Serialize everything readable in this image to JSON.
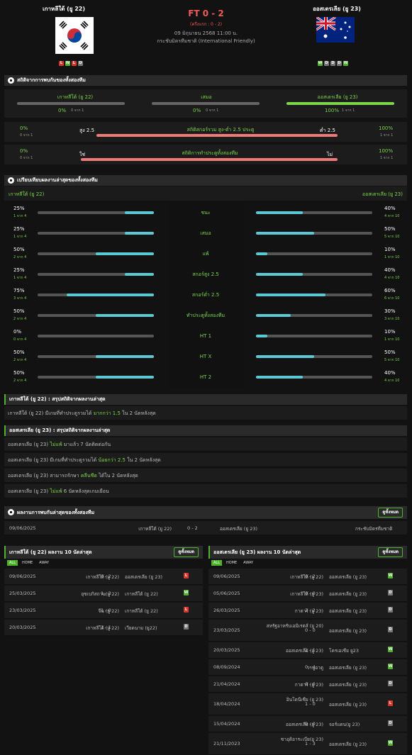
{
  "header": {
    "home_name": "เกาหลีใต้ (ยู 22)",
    "away_name": "ออสเตรเลีย (ยู 23)",
    "score": "FT 0 - 2",
    "halftime": "(ครึ่งแรก : 0 - 2)",
    "date": "09 มิถุนายน 2568 11:00 น.",
    "competition": "กระชับมิตรทีมชาติ (International Friendly)",
    "home_form": [
      "L",
      "W",
      "L",
      "D"
    ],
    "away_form": [
      "W",
      "D",
      "D",
      "D",
      "W"
    ]
  },
  "h2h_section": {
    "title": "สถิติจากการพบกันของทั้งสองทีม",
    "home_label": "เกาหลีใต้ (ยู 22)",
    "draw_label": "เสมอ",
    "away_label": "ออสเตรเลีย (ยู 23)",
    "home_pct": "0%",
    "home_count": "0 จาก 1",
    "draw_pct": "0%",
    "draw_count": "0 จาก 1",
    "away_pct": "100%",
    "away_count": "1 จาก 1",
    "ou_title": "สถิติสกอร์รวม สูง-ต่ำ 2.5 ประตู",
    "ou_left_pct": "0%",
    "ou_left_count": "0 จาก 1",
    "ou_over": "สูง 2.5",
    "ou_under": "ต่ำ 2.5",
    "ou_right_pct": "100%",
    "ou_right_count": "1 จาก 1",
    "btts_title": "สถิติการทำประตูทั้งสองทีม",
    "btts_left_pct": "0%",
    "btts_left_count": "0 จาก 1",
    "btts_yes": "ใช่",
    "btts_no": "ไม่",
    "btts_right_pct": "100%",
    "btts_right_count": "1 จาก 1"
  },
  "compare": {
    "title": "เปรียบเทียบผลงานล่าสุดของทั้งสองทีม",
    "home_label": "เกาหลีใต้ (ยู 22)",
    "away_label": "ออสเตรเลีย (ยู 23)",
    "rows": [
      {
        "label": "ชนะ",
        "home_pct": "25%",
        "home_count": "1 จาก 4",
        "home_val": 0.25,
        "away_pct": "40%",
        "away_count": "4 จาก 10",
        "away_val": 0.4
      },
      {
        "label": "เสมอ",
        "home_pct": "25%",
        "home_count": "1 จาก 4",
        "home_val": 0.25,
        "away_pct": "50%",
        "away_count": "5 จาก 10",
        "away_val": 0.5
      },
      {
        "label": "แพ้",
        "home_pct": "50%",
        "home_count": "2 จาก 4",
        "home_val": 0.5,
        "away_pct": "10%",
        "away_count": "1 จาก 10",
        "away_val": 0.1
      },
      {
        "label": "สกอร์สูง 2.5",
        "home_pct": "25%",
        "home_count": "1 จาก 4",
        "home_val": 0.25,
        "away_pct": "40%",
        "away_count": "4 จาก 10",
        "away_val": 0.4
      },
      {
        "label": "สกอร์ต่ำ 2.5",
        "home_pct": "75%",
        "home_count": "3 จาก 4",
        "home_val": 0.75,
        "away_pct": "60%",
        "away_count": "6 จาก 10",
        "away_val": 0.6
      },
      {
        "label": "ทำประตูทั้งสองทีม",
        "home_pct": "50%",
        "home_count": "2 จาก 4",
        "home_val": 0.5,
        "away_pct": "30%",
        "away_count": "3 จาก 10",
        "away_val": 0.3
      },
      {
        "label": "HT 1",
        "home_pct": "0%",
        "home_count": "0 จาก 4",
        "home_val": 0,
        "away_pct": "10%",
        "away_count": "1 จาก 10",
        "away_val": 0.1
      },
      {
        "label": "HT X",
        "home_pct": "50%",
        "home_count": "2 จาก 4",
        "home_val": 0.5,
        "away_pct": "50%",
        "away_count": "5 จาก 10",
        "away_val": 0.5
      },
      {
        "label": "HT 2",
        "home_pct": "50%",
        "home_count": "2 จาก 4",
        "home_val": 0.5,
        "away_pct": "40%",
        "away_count": "4 จาก 10",
        "away_val": 0.4
      }
    ]
  },
  "home_summary": {
    "title": "เกาหลีใต้ (ยู 22) : สรุปสถิติจากผลงานล่าสุด",
    "line1_a": "เกาหลีใต้ (ยู 22) มีเกมที่ทำประตูรวมได้ ",
    "line1_b": "มากกว่า 1.5",
    "line1_c": " ใน 2 นัดหลังสุด"
  },
  "away_summary": {
    "title": "ออสเตรเลีย (ยู 23) : สรุปสถิติจากผลงานล่าสุด",
    "l1a": "ออสเตรเลีย (ยู 23) ",
    "l1b": "ไม่แพ้",
    "l1c": " มาแล้ว 7 นัดติดต่อกัน",
    "l2a": "ออสเตรเลีย (ยู 23) มีเกมที่ทำประตูรวมได้ ",
    "l2b": "น้อยกว่า 2.5",
    "l2c": " ใน 2 นัดหลังสุด",
    "l3a": "ออสเตรเลีย (ยู 23) สามารถรักษา ",
    "l3b": "คลีนชีต",
    "l3c": " ได้ใน 2 นัดหลังสุด",
    "l4a": "ออสเตรเลีย (ยู 23) ",
    "l4b": "ไม่แพ้",
    "l4c": " 6 นัดหลังสุดเกมเยือน"
  },
  "recent_h2h": {
    "title": "ผลงานการพบกันล่าสุดของทั้งสองทีม",
    "see_all": "ดูทั้งหมด",
    "date": "09/06/2025",
    "home": "เกาหลีใต้ (ยู 22)",
    "score": "0 - 2",
    "away": "ออสเตรเลีย (ยู 23)",
    "comp": "กระชับมิตรทีมชาติ"
  },
  "home_last10": {
    "title": "เกาหลีใต้ (ยู 22) ผลงาน 10 นัดล่าสุด",
    "see_all": "ดูทั้งหมด",
    "tabs": [
      "ALL",
      "HOME",
      "AWAY"
    ],
    "matches": [
      {
        "date": "09/06/2025",
        "home": "เกาหลีใต้ (ยู 22)",
        "score": "0 - 2",
        "away": "ออสเตรเลีย (ยู 23)",
        "res": "L"
      },
      {
        "date": "25/03/2025",
        "home": "อุซเบกิสถาน(ยู 22)",
        "score": "1 - 3",
        "away": "เกาหลีใต้ (ยู 22)",
        "res": "W"
      },
      {
        "date": "23/03/2025",
        "home": "จีน (ยู 22)",
        "score": "1 - 0",
        "away": "เกาหลีใต้ (ยู 22)",
        "res": "L"
      },
      {
        "date": "20/03/2025",
        "home": "เกาหลีใต้ (ยู 22)",
        "score": "1 - 1",
        "away": "เวียดนาม (ยู22)",
        "res": "D"
      }
    ]
  },
  "away_last10": {
    "title": "ออสเตรเลีย (ยู 23) ผลงาน 10 นัดล่าสุด",
    "see_all": "ดูทั้งหมด",
    "tabs": [
      "ALL",
      "HOME",
      "AWAY"
    ],
    "matches": [
      {
        "date": "09/06/2025",
        "home": "เกาหลีใต้ (ยู 22)",
        "score": "0 - 2",
        "away": "ออสเตรเลีย (ยู 23)",
        "res": "W"
      },
      {
        "date": "05/06/2025",
        "home": "เกาหลีใต้ (ยู 23)",
        "score": "0 - 0",
        "away": "ออสเตรเลีย (ยู 23)",
        "res": "D"
      },
      {
        "date": "26/03/2025",
        "home": "กาตาร์ (ยู 23)",
        "score": "2 - 2",
        "away": "ออสเตรเลีย (ยู 23)",
        "res": "D"
      },
      {
        "date": "23/03/2025",
        "home": "สหรัฐอาหรับเอมิเรตส์ (ยู 20)",
        "score": "0 - 0",
        "away": "ออสเตรเลีย (ยู 23)",
        "res": "D"
      },
      {
        "date": "20/03/2025",
        "home": "ออสเตรเลีย (ยู 23)",
        "score": "2 - 1",
        "away": "โครเอเชีย ยู23",
        "res": "W"
      },
      {
        "date": "08/09/2024",
        "home": "วานูอาตู",
        "score": "0 - 4",
        "away": "ออสเตรเลีย (ยู 23)",
        "res": "W"
      },
      {
        "date": "21/04/2024",
        "home": "กาตาร์ (ยู 23)",
        "score": "0 - 0",
        "away": "ออสเตรเลีย (ยู 23)",
        "res": "D"
      },
      {
        "date": "18/04/2024",
        "home": "อินโดนีเซีย (ยู 23)",
        "score": "1 - 0",
        "away": "ออสเตรเลีย (ยู 23)",
        "res": "L"
      },
      {
        "date": "15/04/2024",
        "home": "ออสเตรเลีย (ยู 23)",
        "score": "0 - 0",
        "away": "จอร์แดน(ยู 23)",
        "res": "D"
      },
      {
        "date": "21/11/2023",
        "home": "ซาอุดิอาระเบีย(ยู 23)",
        "score": "1 - 3",
        "away": "ออสเตรเลีย (ยู 23)",
        "res": "W"
      }
    ]
  }
}
